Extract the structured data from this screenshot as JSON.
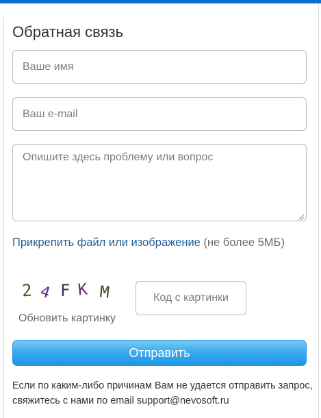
{
  "form": {
    "title": "Обратная связь",
    "name_placeholder": "Ваше имя",
    "email_placeholder": "Ваш e-mail",
    "message_placeholder": "Опишите здесь проблему или вопрос",
    "attach_link": "Прикрепить файл или изображение",
    "attach_note": " (не более 5МБ)",
    "captcha_text": "24FKM",
    "refresh_captcha": "Обновить картинку",
    "captcha_placeholder": "Код с картинки",
    "submit_label": "Отправить",
    "footnote": "Если по каким-либо причинам Вам не удается отправить запрос, свяжитесь с нами по email support@nevosoft.ru"
  },
  "colors": {
    "top_bar": "#0b6fcf",
    "link": "#1f5f98",
    "button": "#1e96e3"
  }
}
